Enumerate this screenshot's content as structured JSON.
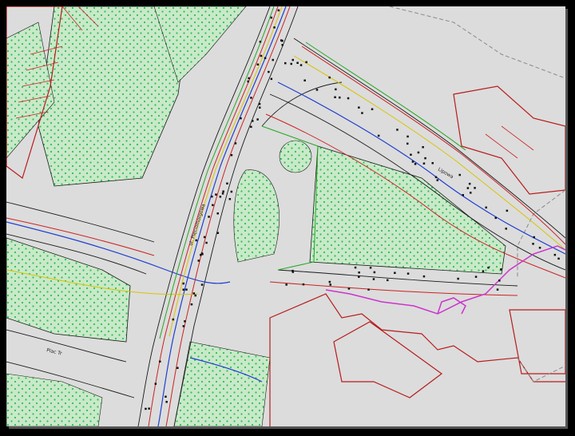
{
  "map": {
    "background_color": "#dcdcdc",
    "frame_color": "#000000",
    "colors": {
      "green_area_fill": "#c6e8c6",
      "green_dots": "#2fbf55",
      "road_black": "#1a1a1a",
      "utility_red": "#cc2222",
      "utility_blue": "#1f3fd1",
      "utility_yellow": "#d8c400",
      "utility_green": "#22a822",
      "utility_magenta": "#cc33cc",
      "building_outline": "#b81c1c",
      "grey_dashed": "#8a8a8a"
    },
    "street_labels": {
      "diagonal_street": "Lipowa",
      "lower_left_street": "Plac Tr",
      "vertical_street_a": "ul. Pięciomorgowa"
    }
  }
}
